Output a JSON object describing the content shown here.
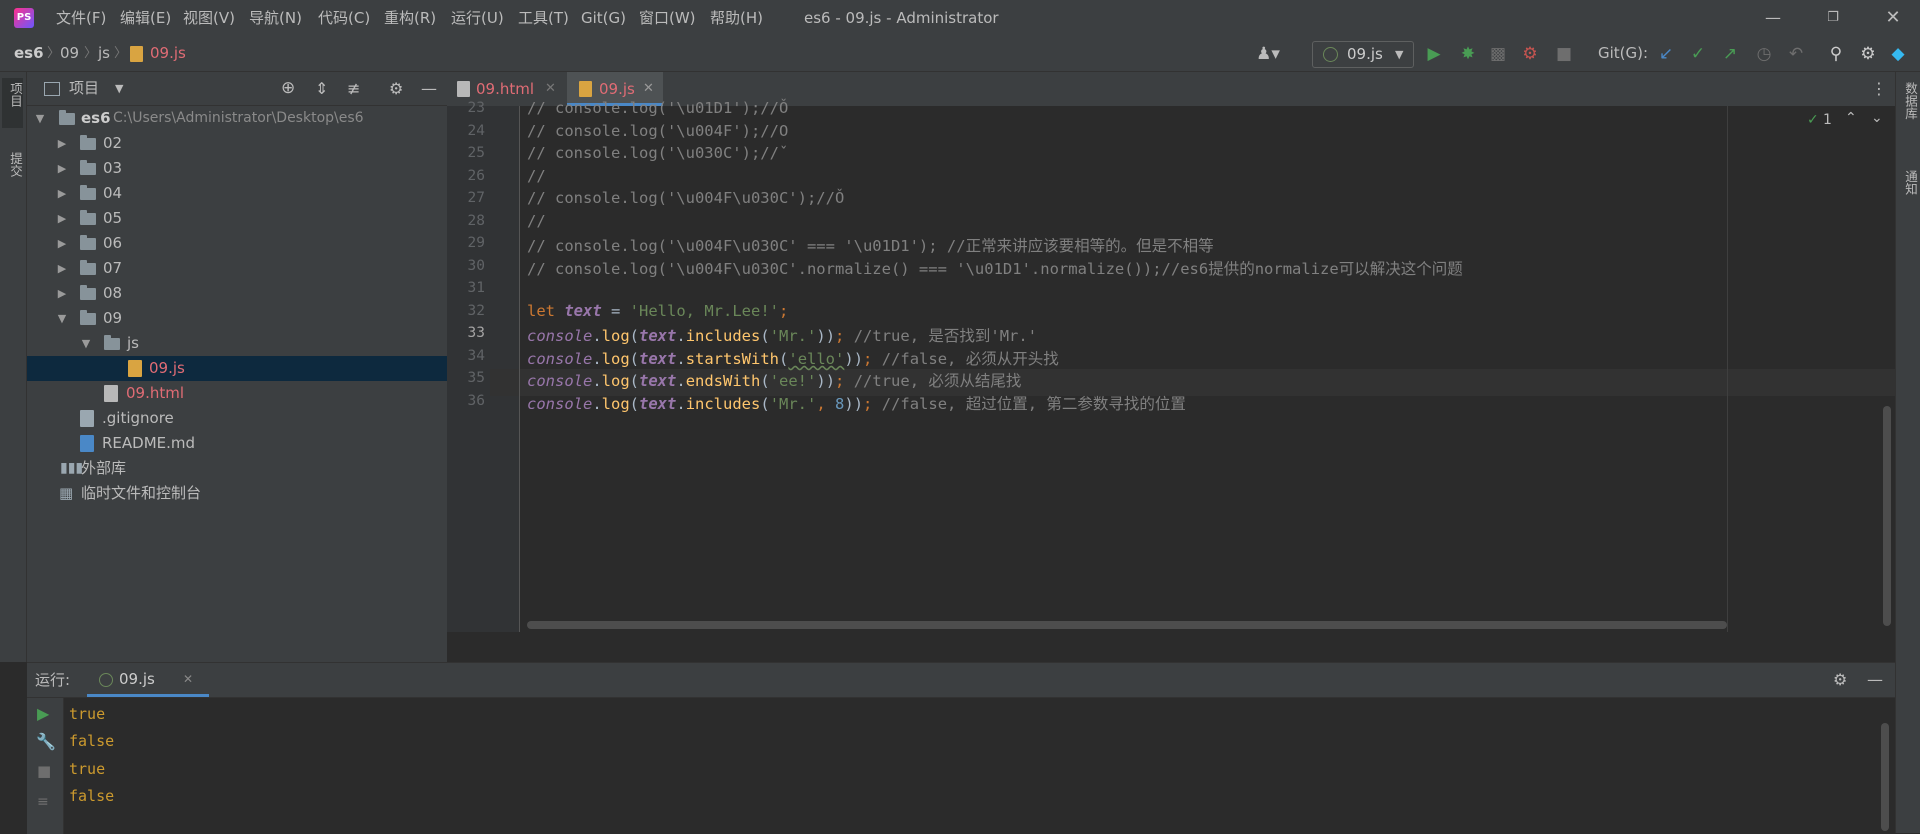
{
  "window": {
    "title": "es6 - 09.js - Administrator",
    "menu": [
      "文件(F)",
      "编辑(E)",
      "视图(V)",
      "导航(N)",
      "代码(C)",
      "重构(R)",
      "运行(U)",
      "工具(T)",
      "Git(G)",
      "窗口(W)",
      "帮助(H)"
    ]
  },
  "breadcrumb": [
    "es6",
    "09",
    "js",
    "09.js"
  ],
  "toolbar": {
    "run_config": "09.js",
    "git_label": "Git(G):"
  },
  "left_strip": [
    "项目",
    "提交"
  ],
  "right_strip": [
    "数据库",
    "通知"
  ],
  "project": {
    "header": "项目",
    "root_name": "es6",
    "root_path": "C:\\Users\\Administrator\\Desktop\\es6",
    "folders": [
      "02",
      "03",
      "04",
      "05",
      "06",
      "07",
      "08",
      "09"
    ],
    "js_folder": "js",
    "js_file": "09.js",
    "html_file": "09.html",
    "gitignore": ".gitignore",
    "readme": "README.md",
    "ext_libs": "外部库",
    "scratches": "临时文件和控制台"
  },
  "tabs": [
    {
      "label": "09.html",
      "active": false
    },
    {
      "label": "09.js",
      "active": true
    }
  ],
  "editor": {
    "inspection_count": "1",
    "line_numbers": [
      "23",
      "24",
      "25",
      "26",
      "27",
      "28",
      "29",
      "30",
      "31",
      "32",
      "33",
      "34",
      "35",
      "36"
    ],
    "lines": {
      "l23": "// console.log('\\u01D1');//Ǒ",
      "l24": "// console.log('\\u004F');//O",
      "l25": "// console.log('\\u030C');//̌",
      "l26": "//",
      "l27": "// console.log('\\u004F\\u030C');//Ǒ",
      "l28": "//",
      "l29": "// console.log('\\u004F\\u030C' === '\\u01D1'); //正常来讲应该要相等的。但是不相等",
      "l30": "// console.log('\\u004F\\u030C'.normalize() === '\\u01D1'.normalize());//es6提供的normalize可以解决这个问题",
      "l32_kw": "let",
      "l32_var": "text",
      "l32_str": "'Hello, Mr.Lee!'",
      "console": "console",
      "log": "log",
      "text": "text",
      "l33_m": "includes",
      "l33_s": "'Mr.'",
      "l33_c": "//true, 是否找到'Mr.'",
      "l34_m": "startsWith",
      "l34_s": "'ello'",
      "l34_c": "//false, 必须从开头找",
      "l35_m": "endsWith",
      "l35_s": "'ee!'",
      "l35_c": "//true, 必须从结尾找",
      "l36_m": "includes",
      "l36_s": "'Mr.'",
      "l36_n": "8",
      "l36_c": "//false, 超过位置, 第二参数寻找的位置"
    }
  },
  "run": {
    "label": "运行:",
    "tab": "09.js",
    "output": [
      "true",
      "false",
      "true",
      "false"
    ]
  },
  "colors": {
    "accent": "#4a88c7",
    "run_green": "#499c54",
    "js_file": "#e06c75",
    "output": "#cc9a2e"
  }
}
